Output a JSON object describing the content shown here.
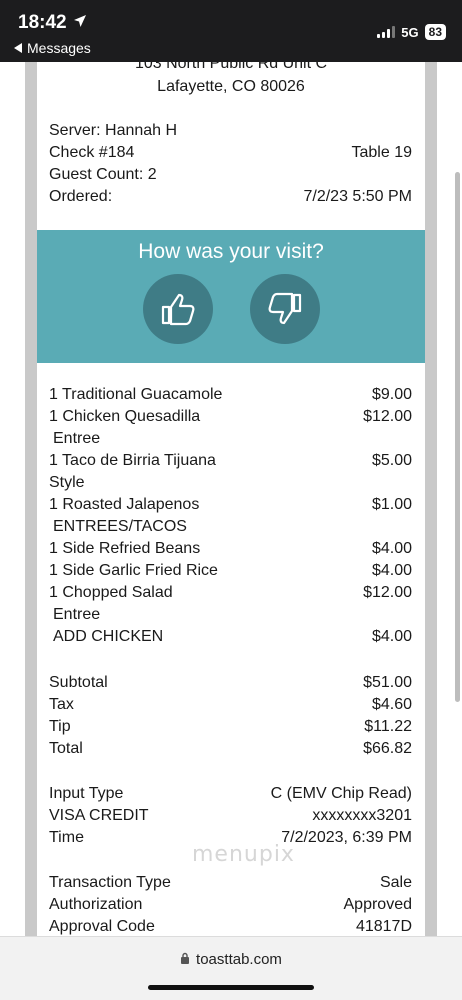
{
  "status": {
    "time": "18:42",
    "back_label": "Messages",
    "network": "5G",
    "battery": "83"
  },
  "receipt": {
    "address_line1": "103 North Public Rd Unit C",
    "address_line2": "Lafayette, CO 80026",
    "server": "Server: Hannah H",
    "check": "Check #184",
    "table": "Table 19",
    "guest_count": "Guest Count: 2",
    "ordered_label": "Ordered:",
    "ordered_value": "7/2/23 5:50 PM",
    "feedback_title": "How was your visit?",
    "items": [
      {
        "name": "1 Traditional Guacamole",
        "price": "$9.00"
      },
      {
        "name": "1 Chicken Quesadilla",
        "price": "$12.00"
      },
      {
        "name": " Entree",
        "price": ""
      },
      {
        "name": "1 Taco de Birria Tijuana",
        "price": "$5.00"
      },
      {
        "name": "Style",
        "price": ""
      },
      {
        "name": "1 Roasted Jalapenos",
        "price": "$1.00"
      },
      {
        "name": " ENTREES/TACOS",
        "price": ""
      },
      {
        "name": "1 Side Refried Beans",
        "price": "$4.00"
      },
      {
        "name": "1 Side Garlic Fried Rice",
        "price": "$4.00"
      },
      {
        "name": "1 Chopped Salad",
        "price": "$12.00"
      },
      {
        "name": " Entree",
        "price": ""
      },
      {
        "name": " ADD CHICKEN",
        "price": "$4.00"
      }
    ],
    "totals": [
      {
        "label": "Subtotal",
        "value": "$51.00"
      },
      {
        "label": "Tax",
        "value": "$4.60"
      },
      {
        "label": "Tip",
        "value": "$11.22"
      },
      {
        "label": "Total",
        "value": "$66.82"
      }
    ],
    "payment": [
      {
        "label": "Input Type",
        "value": "C (EMV Chip Read)"
      },
      {
        "label": "VISA CREDIT",
        "value": "xxxxxxxx3201"
      },
      {
        "label": "Time",
        "value": "7/2/2023, 6:39 PM"
      }
    ],
    "transaction": [
      {
        "label": "Transaction Type",
        "value": "Sale"
      },
      {
        "label": "Authorization",
        "value": "Approved"
      },
      {
        "label": "Approval Code",
        "value": "41817D"
      }
    ]
  },
  "watermark": "menupix",
  "browser": {
    "url": "toasttab.com"
  },
  "colors": {
    "feedback_band": "#5aabb5",
    "thumb_circle": "#3f7c86"
  }
}
